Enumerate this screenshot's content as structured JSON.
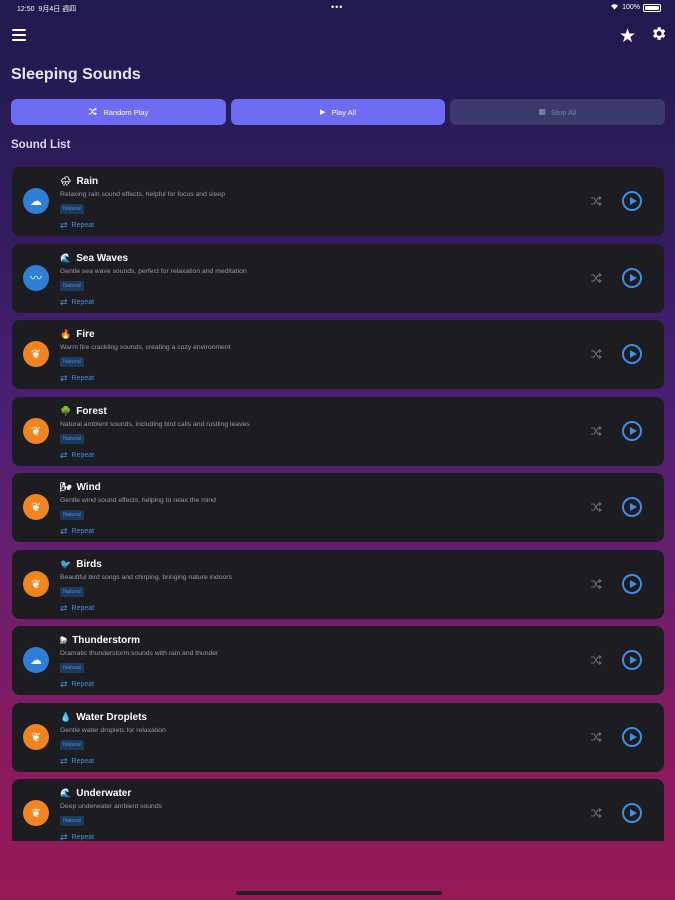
{
  "status": {
    "time": "12:50",
    "date": "9月4日 週四",
    "dots": "•••",
    "battery": "100%"
  },
  "header": {
    "title": "Sleeping Sounds"
  },
  "actions": {
    "random_play": "Random Play",
    "play_all": "Play All",
    "stop_all": "Stop All"
  },
  "section": {
    "title": "Sound List"
  },
  "sounds": [
    {
      "name": "Rain",
      "emoji": "🌧",
      "description": "Relaxing rain sound effects, helpful for focus and sleep",
      "tag": "Natural",
      "repeat": "Repeat",
      "avatar_color": "blue",
      "avatar_icon": "cloud-icon"
    },
    {
      "name": "Sea Waves",
      "emoji": "🌊",
      "description": "Gentle sea wave sounds, perfect for relaxation and meditation",
      "tag": "Natural",
      "repeat": "Repeat",
      "avatar_color": "blue",
      "avatar_icon": "wave-icon"
    },
    {
      "name": "Fire",
      "emoji": "🔥",
      "description": "Warm fire crackling sounds, creating a cozy environment",
      "tag": "Natural",
      "repeat": "Repeat",
      "avatar_color": "orange",
      "avatar_icon": "leaf-icon"
    },
    {
      "name": "Forest",
      "emoji": "🌳",
      "description": "Natural ambient sounds, including bird calls and rustling leaves",
      "tag": "Natural",
      "repeat": "Repeat",
      "avatar_color": "orange",
      "avatar_icon": "leaf-icon"
    },
    {
      "name": "Wind",
      "emoji": "🌬",
      "description": "Gentle wind sound effects, helping to relax the mind",
      "tag": "Natural",
      "repeat": "Repeat",
      "avatar_color": "orange",
      "avatar_icon": "leaf-icon"
    },
    {
      "name": "Birds",
      "emoji": "🐦",
      "description": "Beautiful bird songs and chirping, bringing nature indoors",
      "tag": "Natural",
      "repeat": "Repeat",
      "avatar_color": "orange",
      "avatar_icon": "leaf-icon"
    },
    {
      "name": "Thunderstorm",
      "emoji": "⛈",
      "description": "Dramatic thunderstorm sounds with rain and thunder",
      "tag": "Natural",
      "repeat": "Repeat",
      "avatar_color": "blue",
      "avatar_icon": "cloud-icon"
    },
    {
      "name": "Water Droplets",
      "emoji": "💧",
      "description": "Gentle water droplets for relaxation",
      "tag": "Natural",
      "repeat": "Repeat",
      "avatar_color": "orange",
      "avatar_icon": "leaf-icon"
    },
    {
      "name": "Underwater",
      "emoji": "🌊",
      "description": "Deep underwater ambient sounds",
      "tag": "Natural",
      "repeat": "Repeat",
      "avatar_color": "orange",
      "avatar_icon": "leaf-icon"
    }
  ],
  "colors": {
    "accent": "#6e6cf2",
    "play_blue": "#3e8ee8",
    "card_bg": "#1c1c21",
    "avatar_blue": "#2f7fd6",
    "avatar_orange": "#f08420"
  }
}
